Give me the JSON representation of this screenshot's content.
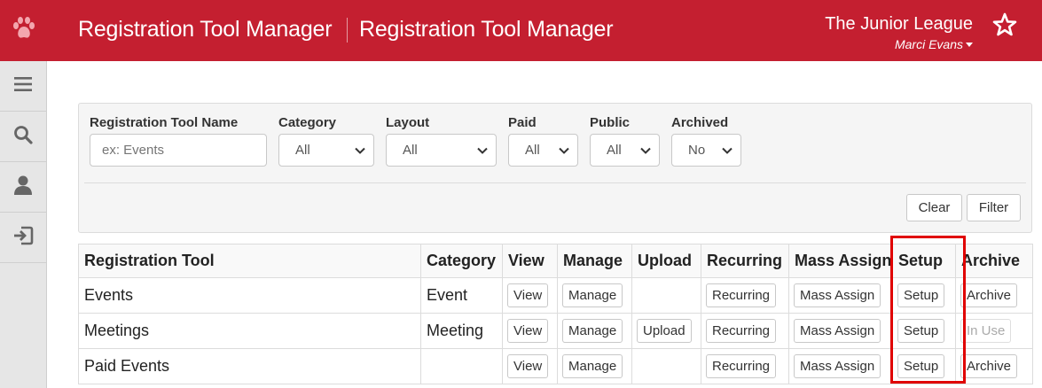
{
  "header": {
    "app_title": "Registration Tool Manager",
    "page_title": "Registration Tool Manager",
    "org_name": "The Junior League",
    "user_name": "Marci Evans",
    "logo_icon": "paw-icon",
    "favorite_icon": "star-icon",
    "bg_color": "#c41f30"
  },
  "sidebar": {
    "items": [
      {
        "icon": "hamburger-menu-icon"
      },
      {
        "icon": "search-icon"
      },
      {
        "icon": "user-icon"
      },
      {
        "icon": "logout-icon"
      }
    ]
  },
  "filters": {
    "name": {
      "label": "Registration Tool Name",
      "placeholder": "ex: Events",
      "value": ""
    },
    "category": {
      "label": "Category",
      "value": "All"
    },
    "layout": {
      "label": "Layout",
      "value": "All"
    },
    "paid": {
      "label": "Paid",
      "value": "All"
    },
    "public": {
      "label": "Public",
      "value": "All"
    },
    "archived": {
      "label": "Archived",
      "value": "No"
    },
    "clear_label": "Clear",
    "filter_label": "Filter"
  },
  "table": {
    "columns": [
      "Registration Tool",
      "Category",
      "View",
      "Manage",
      "Upload",
      "Recurring",
      "Mass Assign",
      "Setup",
      "Archive"
    ],
    "rows": [
      {
        "name": "Events",
        "category": "Event",
        "view": "View",
        "manage": "Manage",
        "upload": "",
        "recurring": "Recurring",
        "mass_assign": "Mass Assign",
        "setup": "Setup",
        "archive": "Archive",
        "archive_disabled": false
      },
      {
        "name": "Meetings",
        "category": "Meeting",
        "view": "View",
        "manage": "Manage",
        "upload": "Upload",
        "recurring": "Recurring",
        "mass_assign": "Mass Assign",
        "setup": "Setup",
        "archive": "In Use",
        "archive_disabled": true
      },
      {
        "name": "Paid Events",
        "category": "",
        "view": "View",
        "manage": "Manage",
        "upload": "",
        "recurring": "Recurring",
        "mass_assign": "Mass Assign",
        "setup": "Setup",
        "archive": "Archive",
        "archive_disabled": false
      }
    ]
  },
  "highlight_color": "#e00000"
}
